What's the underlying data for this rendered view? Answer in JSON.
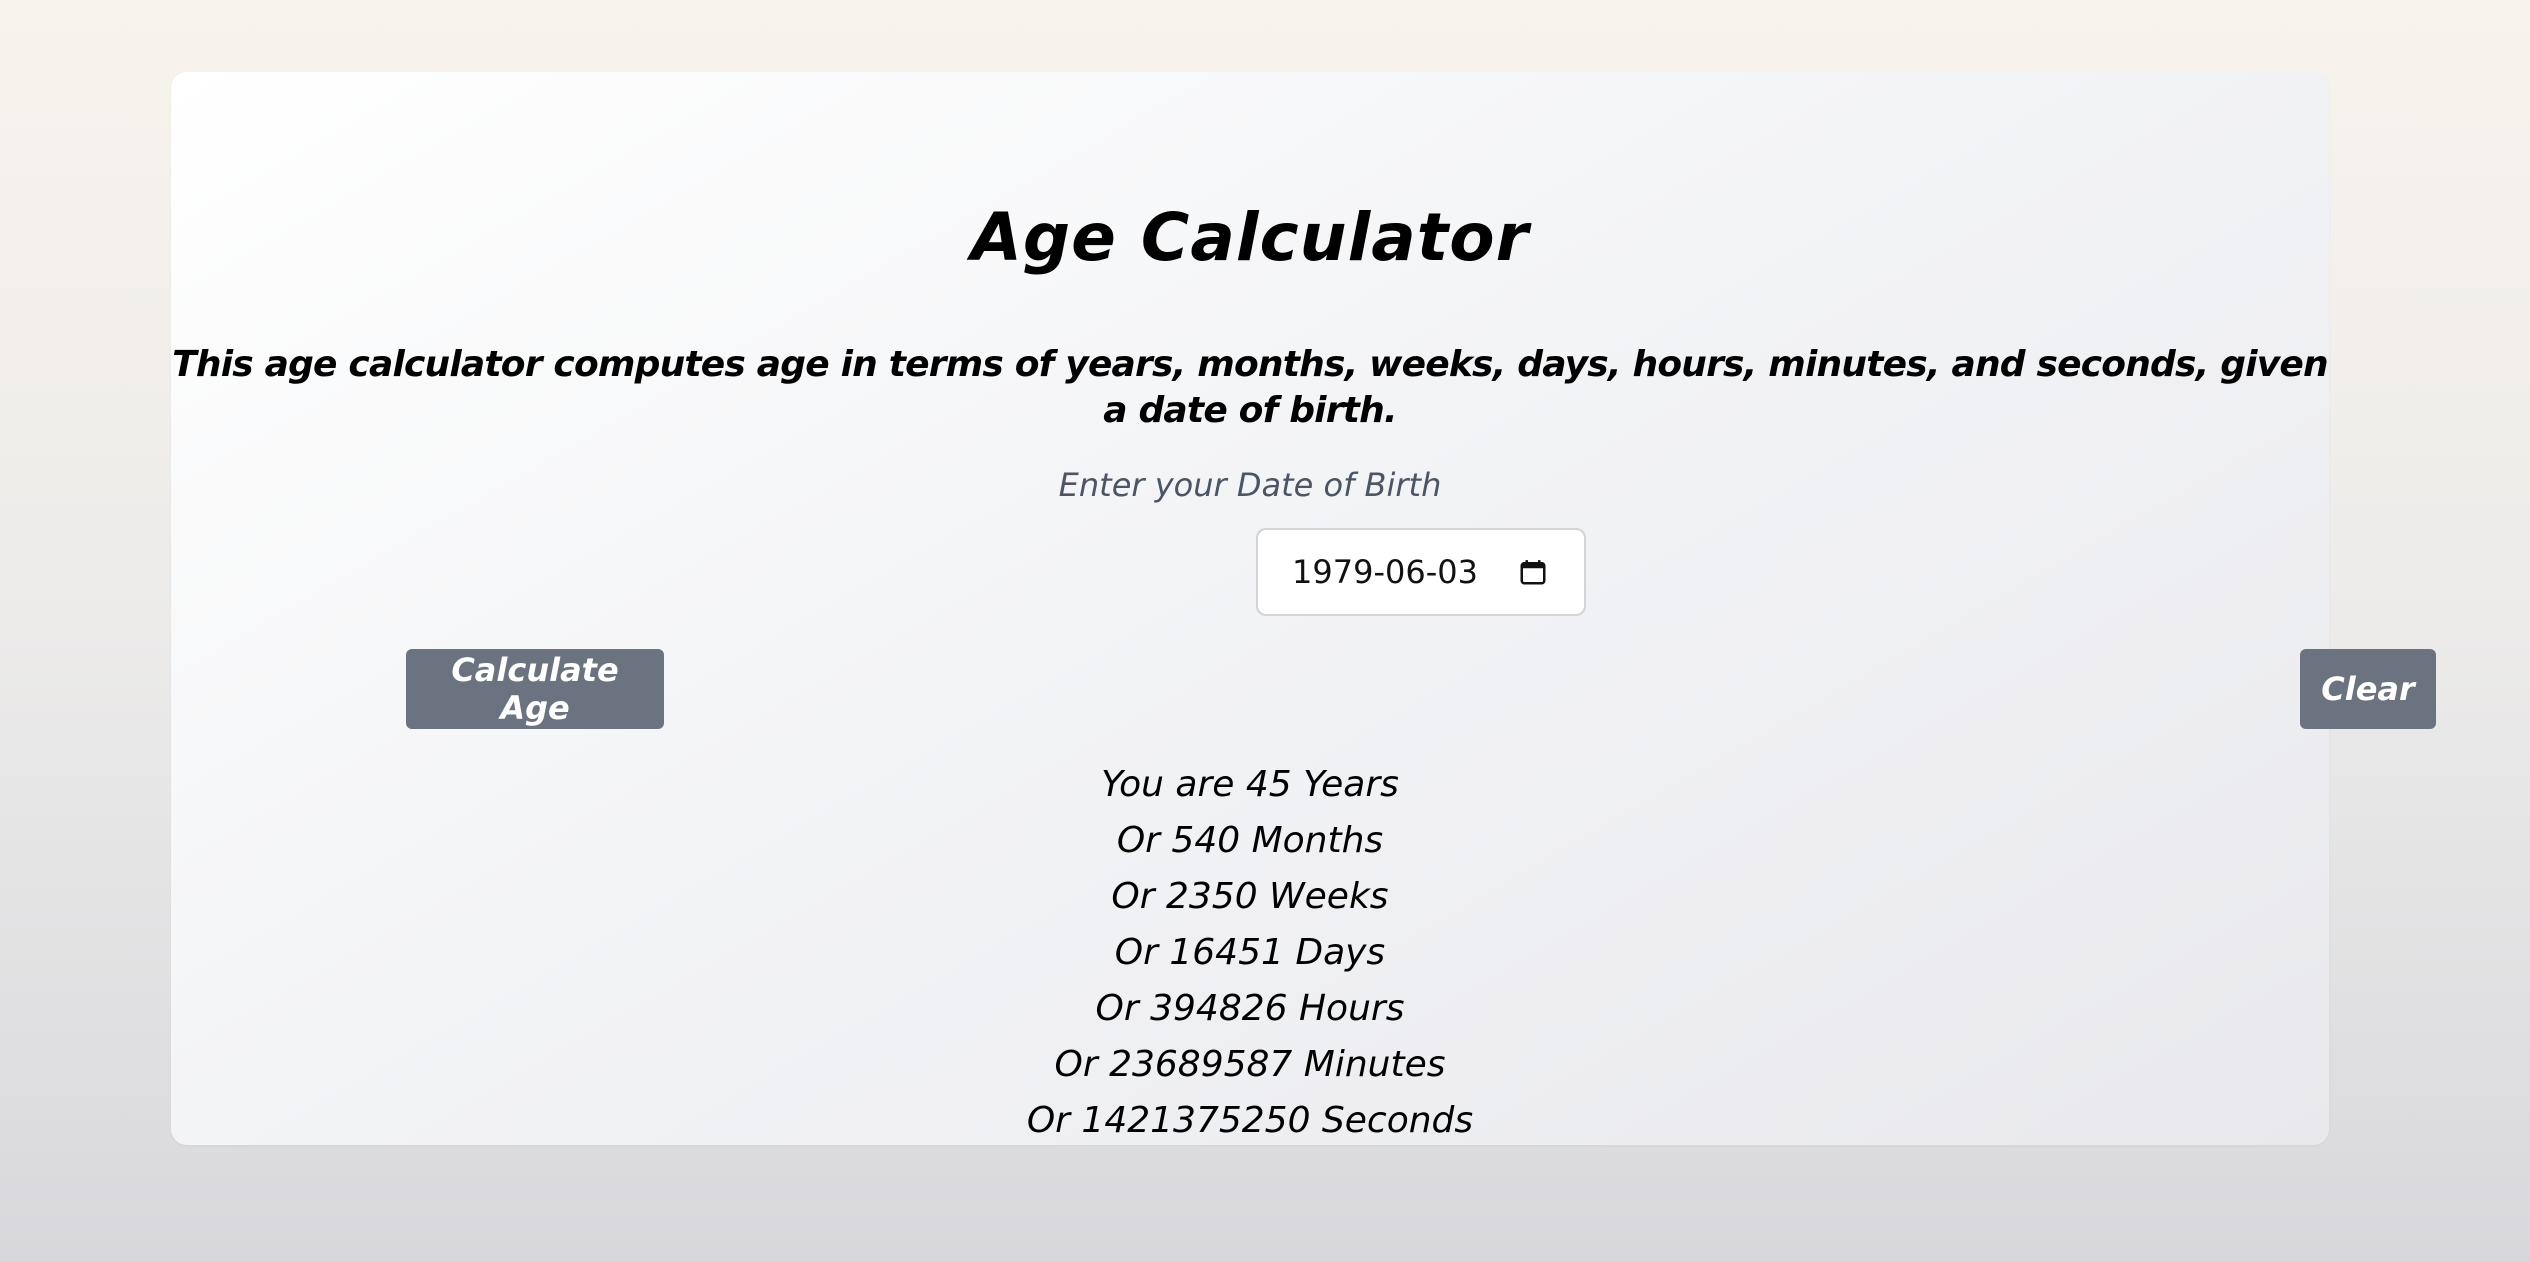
{
  "title": "Age Calculator",
  "description": "This age calculator computes age in terms of years, months, weeks, days, hours, minutes, and seconds, given a date of birth.",
  "dob": {
    "label": "Enter your Date of Birth",
    "value": "1979-06-03",
    "icon": "calendar-icon"
  },
  "buttons": {
    "calculate": "Calculate Age",
    "clear": "Clear"
  },
  "results": [
    "You are 45 Years",
    "Or 540 Months",
    "Or 2350 Weeks",
    "Or 16451 Days",
    "Or 394826 Hours",
    "Or 23689587 Minutes",
    "Or 1421375250 Seconds"
  ],
  "colors": {
    "button_bg": "#6b7280",
    "button_text": "#ffffff",
    "label_text": "#4b5563"
  }
}
